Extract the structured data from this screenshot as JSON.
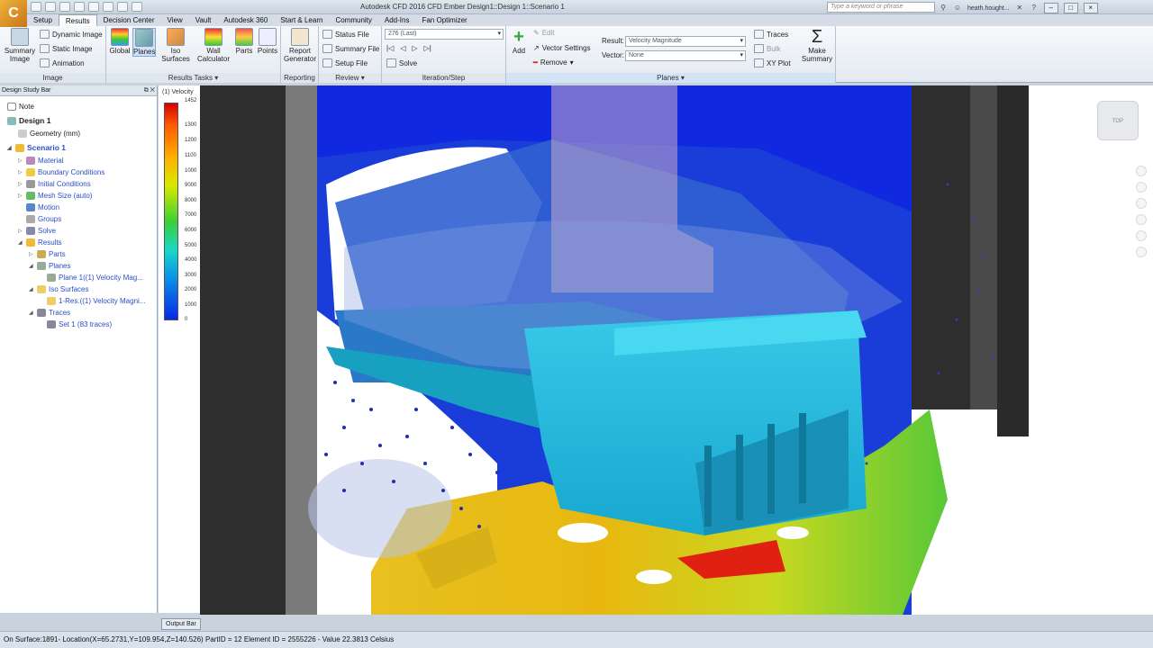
{
  "window": {
    "title": "Autodesk CFD 2016   CFD Ember Design1::Design 1::Scenario 1",
    "search_placeholder": "Type a keyword or phrase",
    "user": "heath.hought..."
  },
  "menu": [
    "Setup",
    "Results",
    "Decision Center",
    "View",
    "Vault",
    "Autodesk 360",
    "Start & Learn",
    "Community",
    "Add-Ins",
    "Fan Optimizer"
  ],
  "ribbon": {
    "image": {
      "label": "Image",
      "summary_image": "Summary Image",
      "dynamic_image": "Dynamic Image",
      "static_image": "Static Image",
      "animation": "Animation"
    },
    "results_tasks": {
      "label": "Results Tasks",
      "global": "Global",
      "planes": "Planes",
      "iso_surfaces": "Iso Surfaces",
      "wall_calculator": "Wall Calculator",
      "parts": "Parts",
      "points": "Points"
    },
    "reporting": {
      "label": "Reporting",
      "report_generator": "Report Generator"
    },
    "review": {
      "label": "Review",
      "status_file": "Status File",
      "summary_file": "Summary File",
      "setup_file": "Setup File"
    },
    "iteration": {
      "label": "Iteration/Step",
      "value": "276 (Last)",
      "solve": "Solve"
    },
    "planes": {
      "label": "Planes",
      "add": "Add",
      "edit": "Edit",
      "vector_settings": "Vector Settings",
      "remove": "Remove",
      "result_label": "Result:",
      "result_value": "Velocity Magnitude",
      "vector_label": "Vector:",
      "vector_value": "None",
      "traces": "Traces",
      "bulk": "Bulk",
      "xy_plot": "XY Plot",
      "make_summary": "Make Summary"
    }
  },
  "design_study_bar": {
    "title": "Design Study Bar",
    "tree": [
      "Note",
      "Design 1",
      "Geometry (mm)",
      "Scenario 1",
      "Material",
      "Boundary Conditions",
      "Initial Conditions",
      "Mesh Size (auto)",
      "Motion",
      "Groups",
      "Solve",
      "Results",
      "Parts",
      "Planes",
      "Plane 1((1) Velocity Mag...",
      "Iso Surfaces",
      "1-Res.((1) Velocity Magni...",
      "Traces",
      "Set 1 (83 traces)"
    ]
  },
  "legend": {
    "title": "(1) Velocity",
    "ticks": [
      "1452",
      "1300",
      "1200",
      "1100",
      "1000",
      "9000",
      "8000",
      "7000",
      "6000",
      "5000",
      "4000",
      "3000",
      "2000",
      "1000",
      "0"
    ]
  },
  "viewcube_label": "TOP",
  "output_bar": "Output Bar",
  "status": "On Surface:1891- Location(X=65.2731,Y=109.954,Z=140.526) PartID = 12 Element ID = 2555226 - Value 22.3813  Celsius"
}
